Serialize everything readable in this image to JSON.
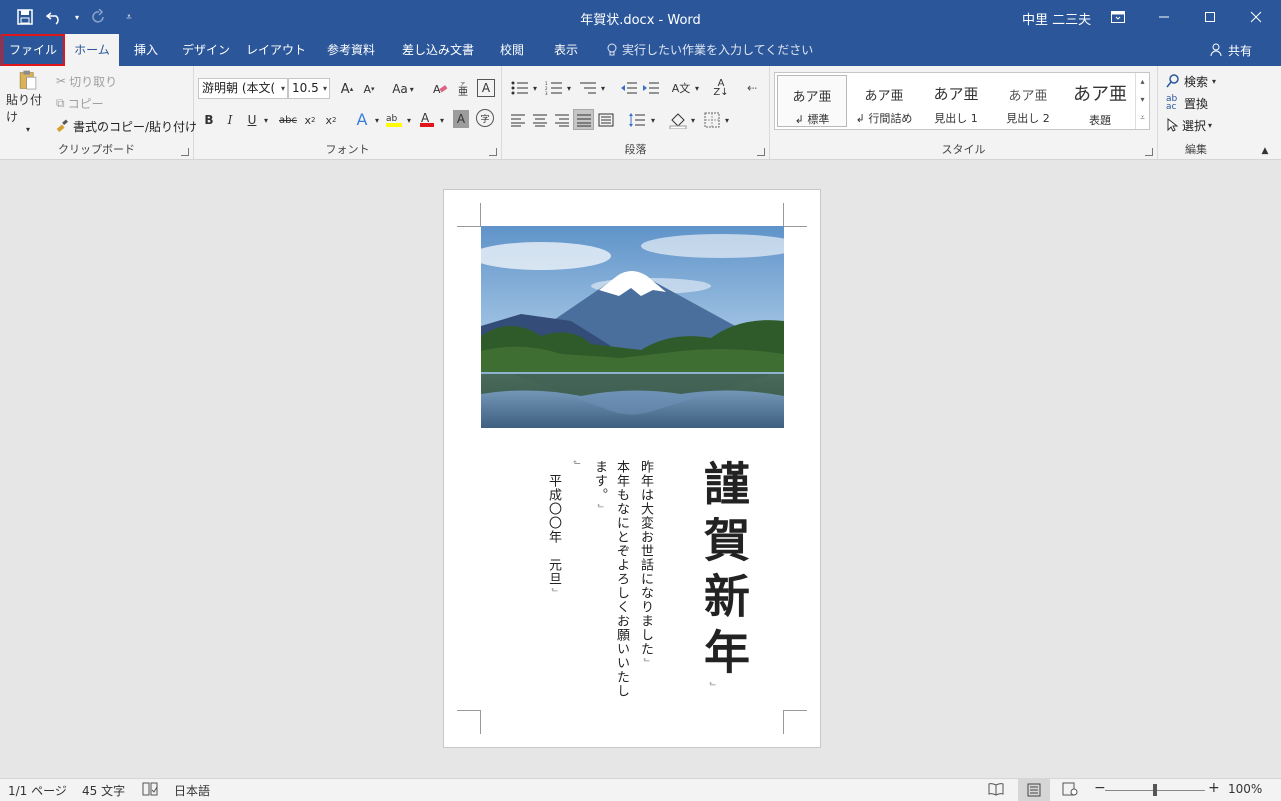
{
  "title_bar": {
    "window_title": "年賀状.docx  -  Word",
    "user_name": "中里 二三夫",
    "bg_color": "#2b579a"
  },
  "tabs": [
    {
      "label": "ファイル",
      "id": "file"
    },
    {
      "label": "ホーム",
      "id": "home"
    },
    {
      "label": "挿入",
      "id": "insert"
    },
    {
      "label": "デザイン",
      "id": "design"
    },
    {
      "label": "レイアウト",
      "id": "layout"
    },
    {
      "label": "参考資料",
      "id": "references"
    },
    {
      "label": "差し込み文書",
      "id": "mailings"
    },
    {
      "label": "校閲",
      "id": "review"
    },
    {
      "label": "表示",
      "id": "view"
    }
  ],
  "tell_me": "実行したい作業を入力してください",
  "share_label": "共有",
  "clipboard": {
    "paste": "貼り付け",
    "cut": "切り取り",
    "copy": "コピー",
    "format_painter": "書式のコピー/貼り付け",
    "group_label": "クリップボード"
  },
  "font": {
    "font_name": "游明朝 (本文(",
    "font_size": "10.5",
    "change_case": "Aa",
    "group_label": "フォント"
  },
  "paragraph": {
    "group_label": "段落"
  },
  "styles": {
    "items": [
      {
        "sample": "あア亜",
        "name": "↲ 標準"
      },
      {
        "sample": "あア亜",
        "name": "↲ 行間詰め"
      },
      {
        "sample": "あア亜",
        "name": "見出し 1"
      },
      {
        "sample": "あア亜",
        "name": "見出し 2"
      },
      {
        "sample": "あア亜",
        "name": "表題"
      }
    ],
    "group_label": "スタイル"
  },
  "editing": {
    "find": "検索",
    "replace": "置換",
    "select": "選択",
    "group_label": "編集"
  },
  "document": {
    "headline": "謹賀新年",
    "line1": "昨年は大変お世話になりました",
    "line2": "本年もなにとぞよろしくお願いいたし",
    "line3": "ます。",
    "date_line": "平成〇〇年　元旦",
    "para_mark": "↲"
  },
  "status": {
    "page": "1/1 ページ",
    "words": "45 文字",
    "language": "日本語",
    "zoom": "100%"
  }
}
